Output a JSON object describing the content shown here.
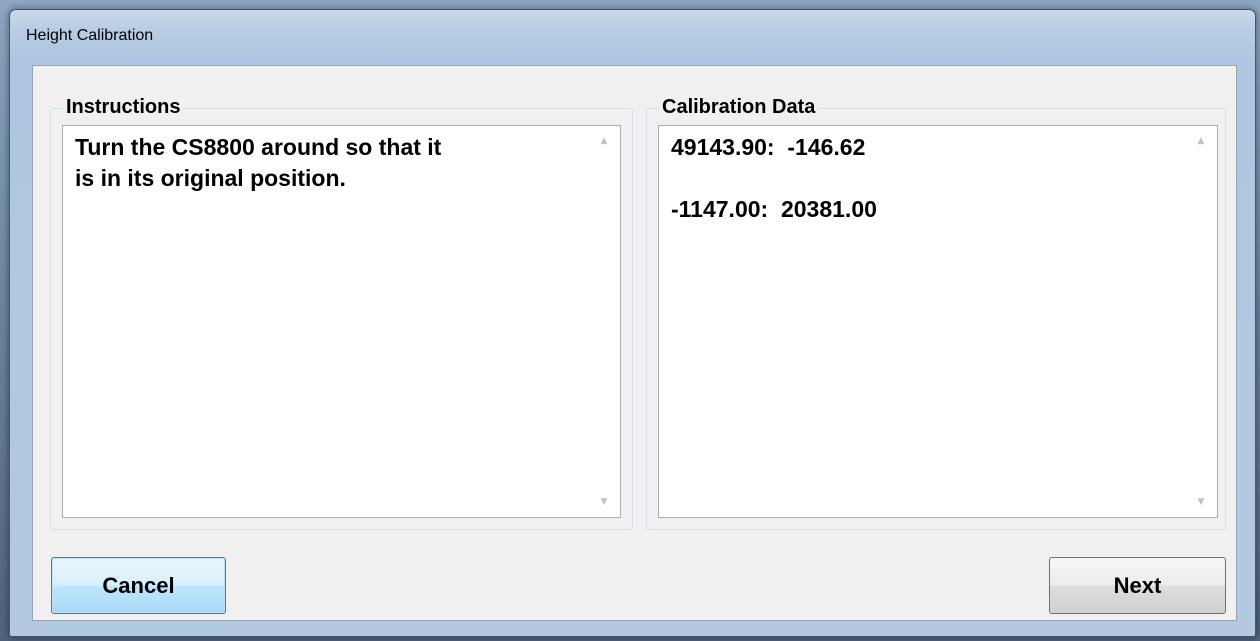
{
  "window": {
    "title": "Height Calibration"
  },
  "instructions": {
    "label": "Instructions",
    "text": "Turn the CS8800 around so that it\nis in its original position."
  },
  "calibration": {
    "label": "Calibration Data",
    "text": "49143.90:  -146.62\n\n-1147.00:  20381.00"
  },
  "buttons": {
    "cancel_label": "Cancel",
    "next_label": "Next"
  },
  "icons": {
    "scroll_up": "scroll-up-arrow",
    "scroll_down": "scroll-down-arrow"
  },
  "colors": {
    "window_frame": "#b7cde3",
    "client_bg": "#f0f0f0",
    "focused_button": "#3c7fb1"
  }
}
